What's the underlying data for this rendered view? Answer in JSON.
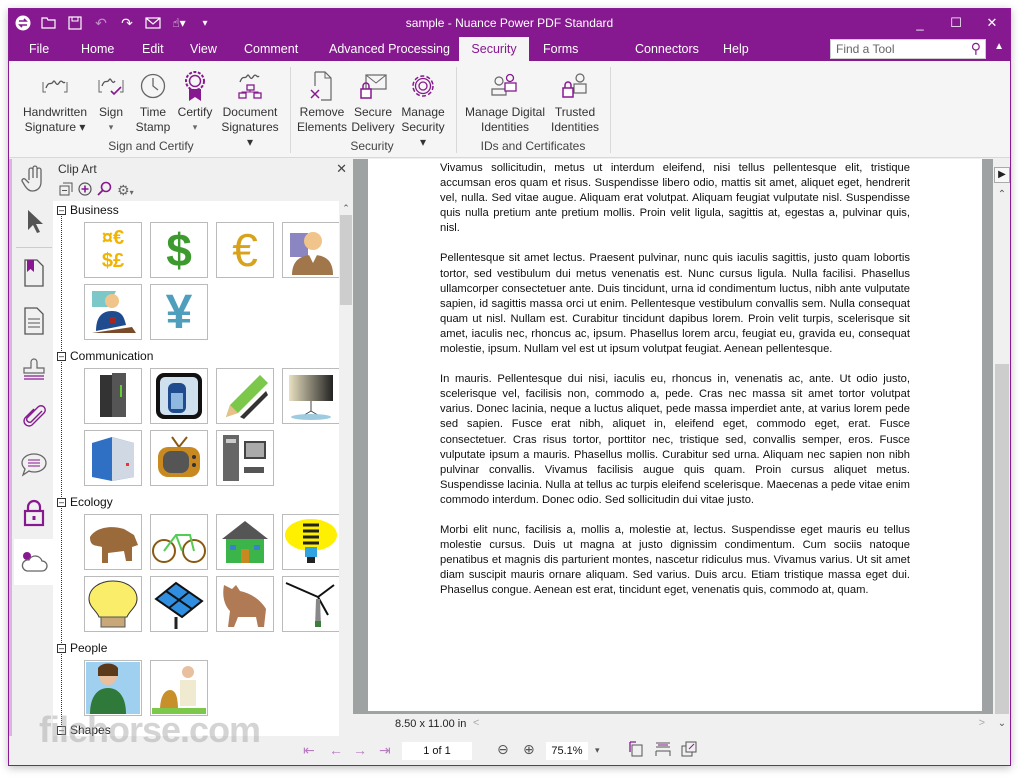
{
  "window": {
    "title": "sample - Nuance Power PDF Standard",
    "quick_access": [
      "app-logo",
      "open-folder",
      "save",
      "undo",
      "redo",
      "email",
      "touch-mode",
      "customize"
    ],
    "controls": {
      "minimize": "_",
      "maximize": "☐",
      "close": "✕"
    }
  },
  "menu": {
    "tabs": [
      "File",
      "Home",
      "Edit",
      "View",
      "Comment",
      "Advanced Processing",
      "Security",
      "Forms",
      "Connectors",
      "Help"
    ],
    "active_tab": "Security",
    "find_placeholder": "Find a Tool"
  },
  "ribbon": {
    "groups": [
      {
        "label": "Sign and Certify",
        "buttons": [
          {
            "line1": "Handwritten",
            "line2": "Signature ▾",
            "icon": "handwritten-signature-icon"
          },
          {
            "line1": "Sign",
            "line2": "▾",
            "icon": "sign-icon"
          },
          {
            "line1": "Time",
            "line2": "Stamp",
            "icon": "clock-icon"
          },
          {
            "line1": "Certify",
            "line2": "▾",
            "icon": "certify-ribbon-icon"
          },
          {
            "line1": "Document",
            "line2": "Signatures ▾",
            "icon": "document-signatures-icon"
          }
        ]
      },
      {
        "label": "Security",
        "buttons": [
          {
            "line1": "Remove",
            "line2": "Elements",
            "icon": "remove-elements-icon"
          },
          {
            "line1": "Secure",
            "line2": "Delivery",
            "icon": "secure-delivery-icon"
          },
          {
            "line1": "Manage",
            "line2": "Security ▾",
            "icon": "gear-icon"
          }
        ]
      },
      {
        "label": "IDs and Certificates",
        "buttons": [
          {
            "line1": "Manage Digital",
            "line2": "Identities",
            "icon": "manage-identities-icon"
          },
          {
            "line1": "Trusted",
            "line2": "Identities",
            "icon": "trusted-identities-icon"
          }
        ]
      }
    ]
  },
  "rail": [
    "hand-tool",
    "select-tool",
    "bookmarks",
    "pages",
    "stamps",
    "attachments",
    "comments",
    "security",
    "cloud"
  ],
  "clipart": {
    "title": "Clip Art",
    "categories": [
      {
        "name": "Business",
        "items": [
          "currency symbols",
          "green dollar",
          "gold euro",
          "businessman",
          "man with coffee",
          "yen sign"
        ]
      },
      {
        "name": "Communication",
        "items": [
          "server rack",
          "cell phone",
          "pencil",
          "projector screen",
          "blue server",
          "television",
          "desktop computer"
        ]
      },
      {
        "name": "Ecology",
        "items": [
          "bear",
          "bicycle",
          "green house",
          "cfl bulb",
          "light bulb",
          "solar panel",
          "cougar",
          "wind turbine"
        ]
      },
      {
        "name": "People",
        "items": [
          "woman",
          "man with dog"
        ]
      },
      {
        "name": "Shapes",
        "items": []
      }
    ]
  },
  "document": {
    "paragraphs": [
      "Vivamus sollicitudin, metus ut interdum eleifend, nisi tellus pellentesque elit, tristique accumsan eros quam et risus. Suspendisse libero odio, mattis sit amet, aliquet eget, hendrerit vel, nulla. Sed vitae augue. Aliquam erat volutpat. Aliquam feugiat vulputate nisl. Suspendisse quis nulla pretium ante pretium mollis. Proin velit ligula, sagittis at, egestas a, pulvinar quis, nisl.",
      "Pellentesque sit amet lectus. Praesent pulvinar, nunc quis iaculis sagittis, justo quam lobortis tortor, sed vestibulum dui metus venenatis est. Nunc cursus ligula. Nulla facilisi. Phasellus ullamcorper consectetuer ante. Duis tincidunt, urna id condimentum luctus, nibh ante vulputate sapien, id sagittis massa orci ut enim. Pellentesque vestibulum convallis sem. Nulla consequat quam ut nisl. Nullam est. Curabitur tincidunt dapibus lorem. Proin velit turpis, scelerisque sit amet, iaculis nec, rhoncus ac, ipsum. Phasellus lorem arcu, feugiat eu, gravida eu, consequat molestie, ipsum. Nullam vel est ut ipsum volutpat feugiat. Aenean pellentesque.",
      "In mauris. Pellentesque dui nisi, iaculis eu, rhoncus in, venenatis ac, ante. Ut odio justo, scelerisque vel, facilisis non, commodo a, pede. Cras nec massa sit amet tortor volutpat varius. Donec lacinia, neque a luctus aliquet, pede massa imperdiet ante, at varius lorem pede sed sapien. Fusce erat nibh, aliquet in, eleifend eget, commodo eget, erat. Fusce consectetuer. Cras risus tortor, porttitor nec, tristique sed, convallis semper, eros. Fusce vulputate ipsum a mauris. Phasellus mollis. Curabitur sed urna. Aliquam nec sapien non nibh pulvinar convallis. Vivamus facilisis augue quis quam. Proin cursus aliquet metus. Suspendisse lacinia. Nulla at tellus ac turpis eleifend scelerisque. Maecenas a pede vitae enim commodo interdum. Donec odio. Sed sollicitudin dui vitae justo.",
      "Morbi elit nunc, facilisis a, mollis a, molestie at, lectus. Suspendisse eget mauris eu tellus molestie cursus. Duis ut magna at justo dignissim condimentum. Cum sociis natoque penatibus et magnis dis parturient montes, nascetur ridiculus mus. Vivamus varius. Ut sit amet diam suscipit mauris ornare aliquam. Sed varius. Duis arcu. Etiam tristique massa eget dui. Phasellus congue. Aenean est erat, tincidunt eget, venenatis quis, commodo at, quam."
    ]
  },
  "status": {
    "page_size": "8.50 x 11.00 in",
    "page_indicator": "1 of 1",
    "zoom": "75.1%"
  },
  "watermark": "filehorse.com",
  "colors": {
    "accent": "#86198f",
    "nav_arrows": "#b77cc0"
  }
}
